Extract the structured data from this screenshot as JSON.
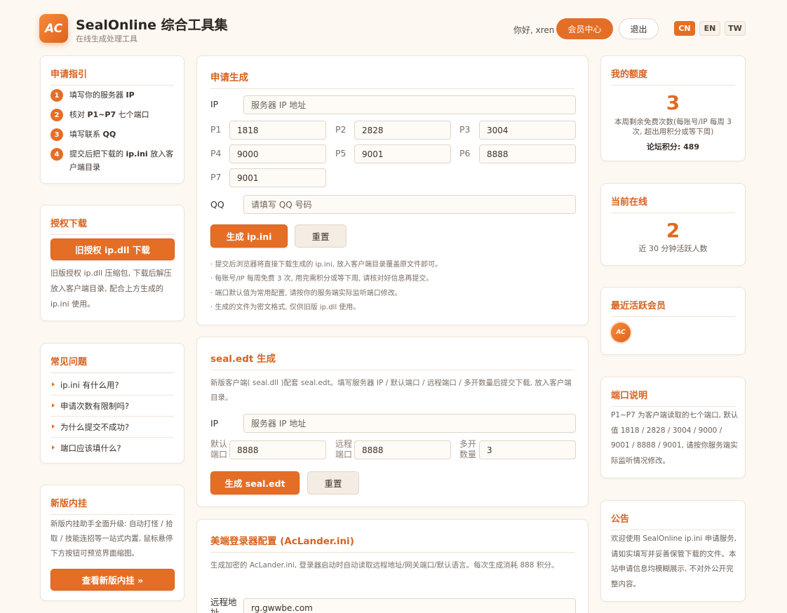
{
  "header": {
    "logo_text": "AC",
    "title": "SealOnline 综合工具集",
    "subtitle": "在线生成处理工具",
    "greeting": "你好, xren",
    "member_btn": "会员中心",
    "logout_btn": "退出",
    "langs": [
      "CN",
      "EN",
      "TW"
    ],
    "active_lang": "CN",
    "accent_color": "#e56e26"
  },
  "guide": {
    "title": "申请指引",
    "steps": [
      {
        "num": "1",
        "pre": "填写你的服务器 ",
        "bold": "IP",
        "post": ""
      },
      {
        "num": "2",
        "pre": "核对 ",
        "bold": "P1~P7",
        "post": " 七个端口"
      },
      {
        "num": "3",
        "pre": "填写联系 ",
        "bold": "QQ",
        "post": ""
      },
      {
        "num": "4",
        "pre": "提交后把下载的 ",
        "bold": "ip.ini",
        "post": " 放入客户端目录"
      }
    ]
  },
  "auth": {
    "title": "授权下载",
    "button": "旧授权 ip.dll 下载",
    "text": "旧版授权 ip.dll 压缩包, 下载后解压放入客户端目录, 配合上方生成的 ip.ini 使用。"
  },
  "faq": {
    "title": "常见问题",
    "items": [
      "ip.ini 有什么用?",
      "申请次数有限制吗?",
      "为什么提交不成功?",
      "端口应该填什么?"
    ]
  },
  "plugin": {
    "title": "新版内挂",
    "text": "新版内挂助手全面升级: 自动打怪 / 拾取 / 技能连招等一站式内置, 鼠标悬停下方按钮可预览界面缩图。",
    "button": "查看新版内挂 »"
  },
  "apply": {
    "title": "申请生成",
    "ip_label": "IP",
    "ip_placeholder": "服务器 IP 地址",
    "ports": [
      {
        "label": "P1",
        "value": "1818"
      },
      {
        "label": "P2",
        "value": "2828"
      },
      {
        "label": "P3",
        "value": "3004"
      },
      {
        "label": "P4",
        "value": "9000"
      },
      {
        "label": "P5",
        "value": "9001"
      },
      {
        "label": "P6",
        "value": "8888"
      },
      {
        "label": "P7",
        "value": "9001"
      }
    ],
    "qq_label": "QQ",
    "qq_placeholder": "请填写 QQ 号码",
    "generate_btn": "生成 ip.ini",
    "reset_btn": "重置",
    "notes": [
      "· 提交后浏览器将直接下载生成的 ip.ini, 放入客户端目录覆盖原文件即可。",
      "· 每账号/IP 每周免费 3 次, 用完需积分或等下周, 请核对好信息再提交。",
      "· 端口默认值为常用配置, 请按你的服务端实际监听端口修改。",
      "· 生成的文件为密文格式, 仅供旧版 ip.dll 使用。"
    ]
  },
  "edt": {
    "title": "seal.edt 生成",
    "desc": "新版客户端( seal.dll )配套 seal.edt。填写服务器 IP / 默认端口 / 远程端口 / 多开数量后提交下载, 放入客户端目录。",
    "ip_label": "IP",
    "ip_placeholder": "服务器 IP 地址",
    "default_port_label": "默认端口",
    "default_port_value": "8888",
    "remote_port_label": "远程端口",
    "remote_port_value": "8888",
    "multi_label": "多开数量",
    "multi_value": "3",
    "generate_btn": "生成 seal.edt",
    "reset_btn": "重置"
  },
  "lander": {
    "title": "美端登录器配置 (AcLander.ini)",
    "desc": "生成加密的 AcLander.ini, 登录器启动时自动读取远程地址/网关端口/默认语言。每次生成消耗 888 积分。",
    "remote_label": "远程地址",
    "remote_placeholder": "rg.gwwbe.com"
  },
  "quota": {
    "title": "我的额度",
    "value": "3",
    "desc": "本周剩余免费次数(每账号/IP 每周 3 次, 超出用积分或等下周)",
    "score": "论坛积分: 489"
  },
  "online": {
    "title": "当前在线",
    "value": "2",
    "desc": "近 30 分钟活跃人数"
  },
  "active": {
    "title": "最近活跃会员",
    "avatar_text": "AC"
  },
  "ports_info": {
    "title": "端口说明",
    "text": "P1~P7 为客户端读取的七个端口, 默认值 1818 / 2828 / 3004 / 9000 / 9001 / 8888 / 9001, 请按你服务端实际监听情况修改。"
  },
  "notice": {
    "title": "公告",
    "text": "欢迎使用 SealOnline ip.ini 申请服务, 请如实填写并妥善保管下载的文件。本站申请信息均模糊展示, 不对外公开完整内容。"
  }
}
